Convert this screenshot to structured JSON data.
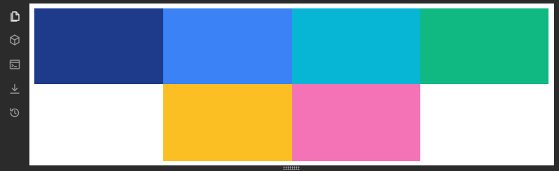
{
  "sidebar": {
    "icons": [
      "files-icon",
      "package-icon",
      "terminal-icon",
      "download-icon",
      "history-icon"
    ],
    "active": "files-icon"
  },
  "preview": {
    "swatch_colors": [
      "#1e3a8a",
      "#3b82f6",
      "#06b6d4",
      "#10b981",
      "#fbbf24",
      "#f472b6"
    ]
  }
}
